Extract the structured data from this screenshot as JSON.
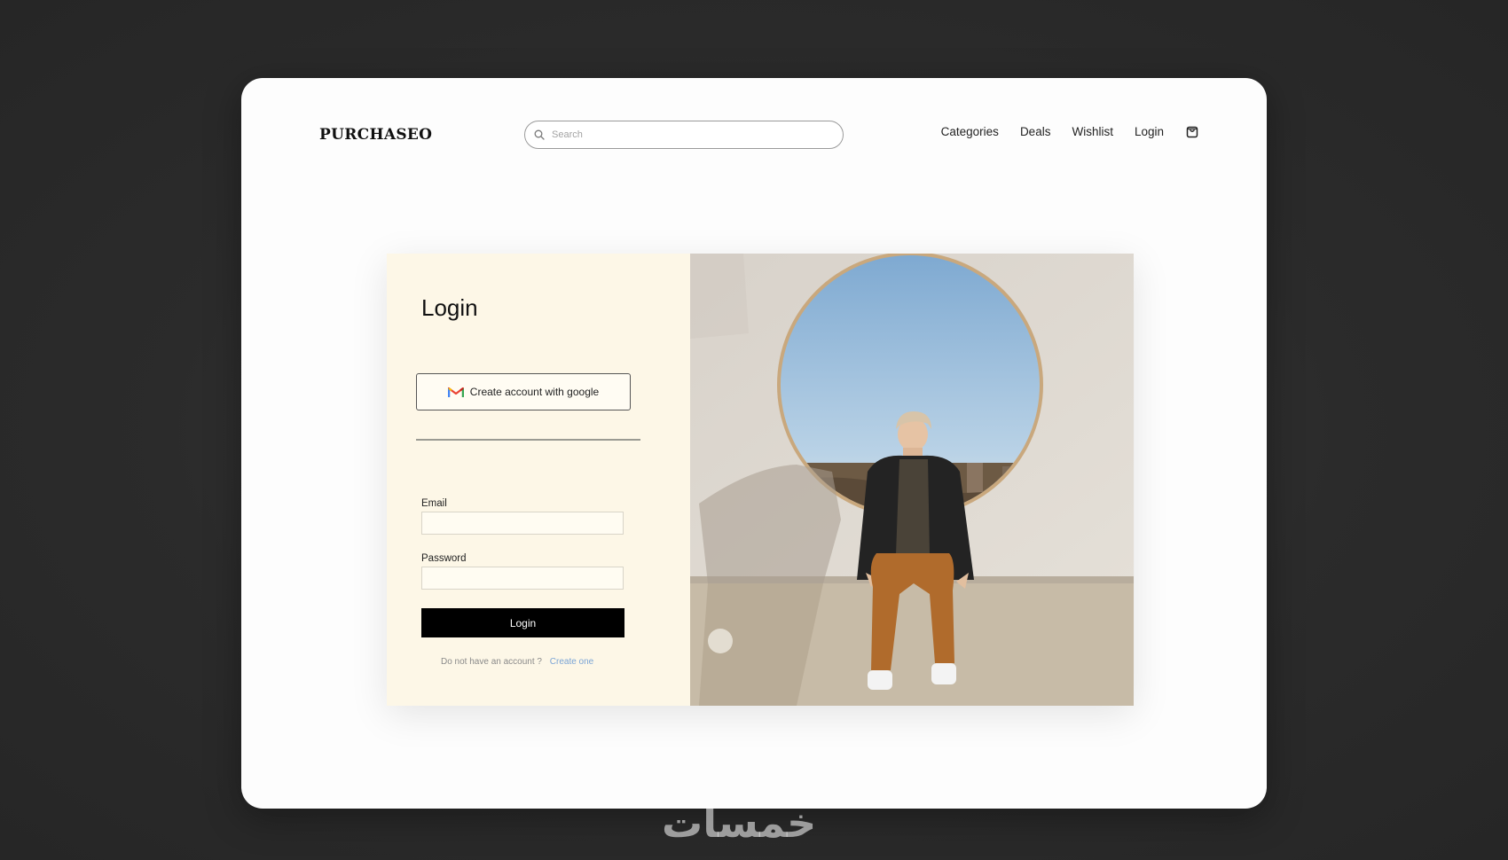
{
  "header": {
    "logo": "PURCHASEO",
    "search_placeholder": "Search",
    "nav": {
      "categories": "Categories",
      "deals": "Deals",
      "wishlist": "Wishlist",
      "login": "Login"
    },
    "cart_icon": "shopping-bag-icon"
  },
  "login": {
    "title": "Login",
    "google_button": "Create account with google",
    "google_icon": "gmail-icon",
    "email_label": "Email",
    "email_value": "",
    "password_label": "Password",
    "password_value": "",
    "submit_label": "Login",
    "no_account_text": "Do not have an account ?",
    "create_link": "Create one"
  },
  "watermark": "خمسات",
  "colors": {
    "background": "#2b2b2b",
    "frame": "#fdfdfd",
    "panel": "#fdf7e7",
    "button": "#000000",
    "link": "#7aa4d6"
  }
}
